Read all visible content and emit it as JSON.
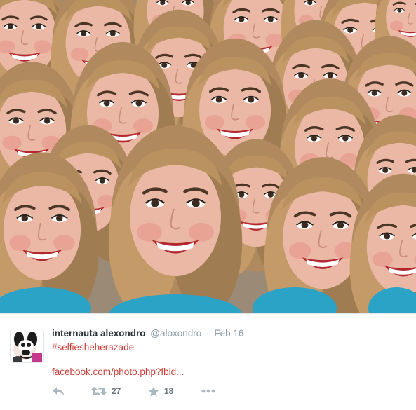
{
  "tweet": {
    "author": {
      "display_name": "internauta alexondro",
      "username": "@aloxondro",
      "separator": "·"
    },
    "timestamp": "Feb 16",
    "hashtag": "#selfiesheherazade",
    "link_text": "facebook.com/photo.php?fbid...",
    "actions": {
      "reply_icon": "reply-arrow",
      "retweet_icon": "retweet-arrows",
      "retweet_count": "27",
      "favorite_icon": "star",
      "favorite_count": "18",
      "more_icon": "ellipsis"
    },
    "colors": {
      "link": "#cc3d36",
      "name": "#292f33",
      "meta": "#8899a6",
      "action": "#aab8c2"
    }
  },
  "media": {
    "description_icon": "face-collage-photo"
  }
}
